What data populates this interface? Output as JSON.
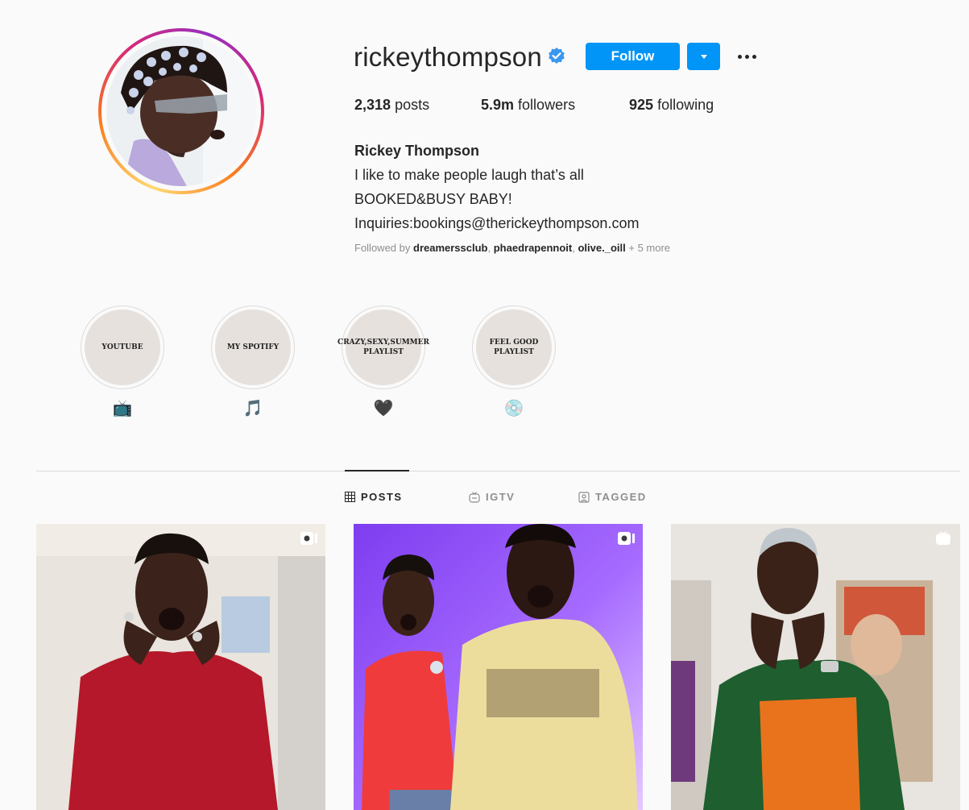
{
  "profile": {
    "username": "rickeythompson",
    "verified": true,
    "follow_label": "Follow",
    "stats": {
      "posts_count": "2,318",
      "posts_label": "posts",
      "followers_count": "5.9m",
      "followers_label": "followers",
      "following_count": "925",
      "following_label": "following"
    },
    "bio": {
      "full_name": "Rickey Thompson",
      "lines": [
        "I like to make people laugh that’s all",
        "BOOKED&BUSY BABY!",
        "Inquiries:bookings@therickeythompson.com"
      ]
    },
    "followed_by": {
      "prefix": "Followed by",
      "users": [
        "dreamerssclub",
        "phaedrapennoit",
        "olive._oill"
      ],
      "more": "+ 5 more"
    }
  },
  "highlights": [
    {
      "title": "Youtube",
      "emoji": "📺"
    },
    {
      "title": "My Spotify",
      "emoji": "🎵"
    },
    {
      "title": "Crazy,Sexy,Summer Playlist",
      "emoji": "🖤"
    },
    {
      "title": "Feel Good Playlist",
      "emoji": "💿"
    }
  ],
  "tabs": [
    {
      "label": "POSTS",
      "icon": "grid-icon",
      "active": true
    },
    {
      "label": "IGTV",
      "icon": "igtv-icon",
      "active": false
    },
    {
      "label": "TAGGED",
      "icon": "tagged-icon",
      "active": false
    }
  ],
  "posts": [
    {
      "type": "video",
      "icon": "video-icon"
    },
    {
      "type": "video",
      "icon": "video-icon"
    },
    {
      "type": "igtv",
      "icon": "igtv-icon"
    }
  ],
  "colors": {
    "accent": "#0095f6",
    "text": "#262626",
    "muted": "#8e8e8e",
    "background": "#fafafa"
  }
}
